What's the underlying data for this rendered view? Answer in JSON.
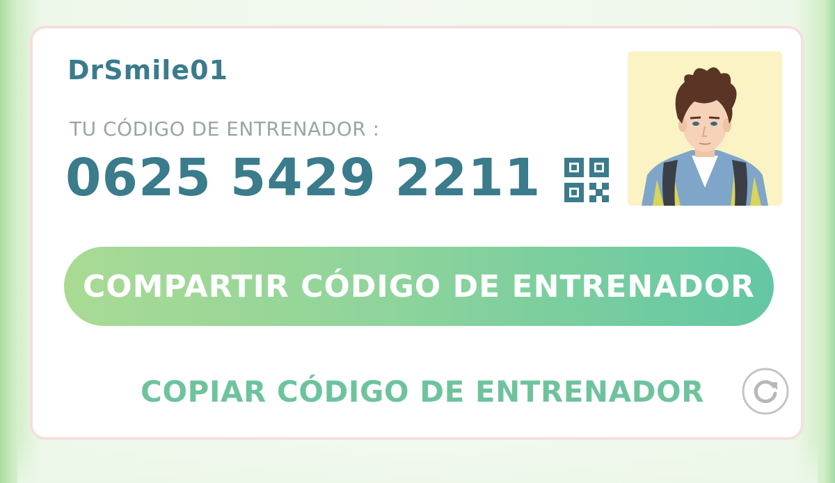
{
  "trainer": {
    "name": "DrSmile01",
    "code_label": "TU CÓDIGO DE ENTRENADOR :",
    "code": "0625 5429 2211"
  },
  "actions": {
    "share_label": "COMPARTIR CÓDIGO DE ENTRENADOR",
    "copy_label": "COPIAR CÓDIGO DE ENTRENADOR"
  },
  "icons": {
    "qr": "qr-code-icon",
    "refresh": "refresh-icon",
    "avatar": "trainer-avatar"
  },
  "colors": {
    "primary_text": "#3a7b8c",
    "label_text": "#9aa4a6",
    "accent_green": "#6ec39d",
    "button_gradient_start": "#a9da94",
    "button_gradient_end": "#63c7a3",
    "card_border": "#f6dede",
    "avatar_background": "#fbf3c4"
  }
}
